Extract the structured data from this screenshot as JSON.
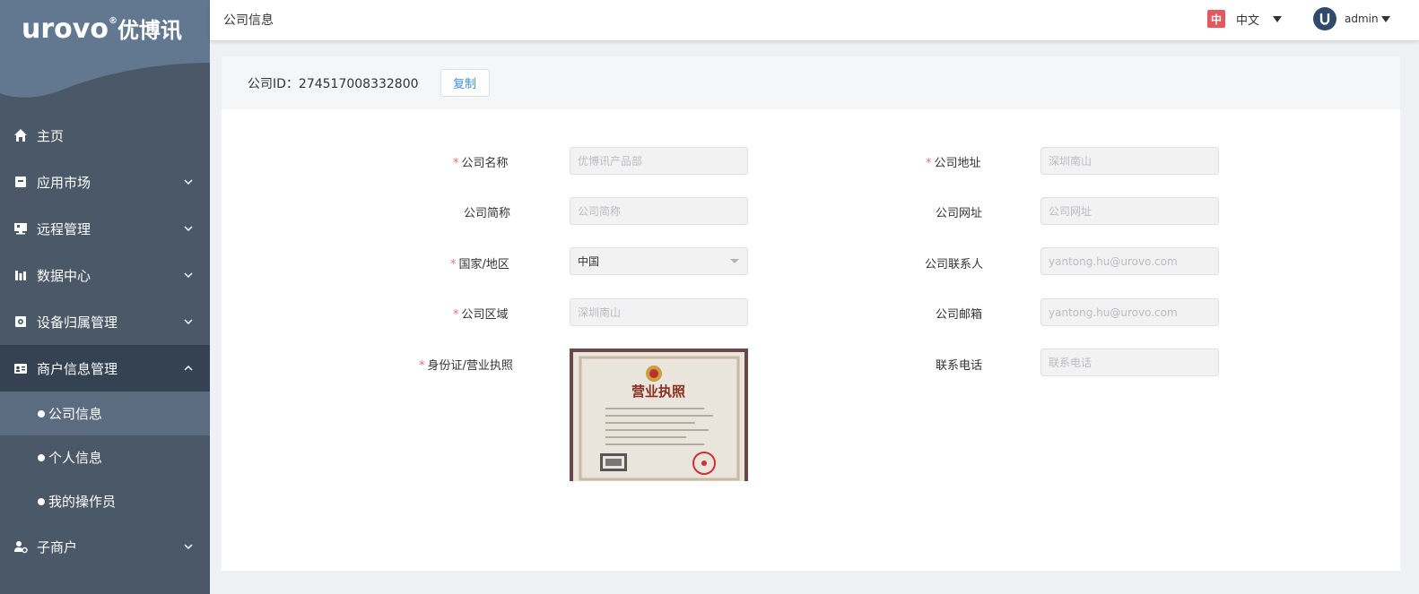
{
  "brand": {
    "logo_text": "urovo",
    "logo_cn": "优博讯",
    "reg_mark": "®"
  },
  "header": {
    "title": "公司信息",
    "lang_badge": "中",
    "lang_label": "中文",
    "user_name": "admin"
  },
  "sidebar": {
    "items": [
      {
        "label": "主页",
        "icon": "home-icon",
        "expandable": false
      },
      {
        "label": "应用市场",
        "icon": "store-icon",
        "expandable": true
      },
      {
        "label": "远程管理",
        "icon": "remote-icon",
        "expandable": true
      },
      {
        "label": "数据中心",
        "icon": "chart-icon",
        "expandable": true
      },
      {
        "label": "设备归属管理",
        "icon": "device-icon",
        "expandable": true
      },
      {
        "label": "商户信息管理",
        "icon": "id-card-icon",
        "expandable": true,
        "open": true
      },
      {
        "label": "子商户",
        "icon": "user-gear-icon",
        "expandable": true
      }
    ],
    "sub_items": [
      {
        "label": "公司信息",
        "active": true
      },
      {
        "label": "个人信息",
        "active": false
      },
      {
        "label": "我的操作员",
        "active": false
      }
    ]
  },
  "company": {
    "id_label": "公司ID：274517008332800",
    "copy_label": "复制"
  },
  "form": {
    "left": [
      {
        "label": "公司名称",
        "required": true,
        "placeholder": "优博讯产品部",
        "value": ""
      },
      {
        "label": "公司简称",
        "required": false,
        "placeholder": "公司简称",
        "value": ""
      },
      {
        "label": "国家/地区",
        "required": true,
        "placeholder": "",
        "value": "中国",
        "select": true
      },
      {
        "label": "公司区域",
        "required": true,
        "placeholder": "深圳南山",
        "value": ""
      },
      {
        "label": "身份证/营业执照",
        "required": true
      }
    ],
    "right": [
      {
        "label": "公司地址",
        "required": true,
        "placeholder": "深圳南山",
        "value": ""
      },
      {
        "label": "公司网址",
        "required": false,
        "placeholder": "公司网址",
        "value": ""
      },
      {
        "label": "公司联系人",
        "required": false,
        "placeholder": "yantong.hu@urovo.com",
        "value": ""
      },
      {
        "label": "公司邮箱",
        "required": false,
        "placeholder": "yantong.hu@urovo.com",
        "value": ""
      },
      {
        "label": "联系电话",
        "required": false,
        "placeholder": "联系电话",
        "value": ""
      }
    ],
    "license_title": "营业执照"
  },
  "colors": {
    "sidebar": "#4a5868",
    "sidebar_open": "#344252",
    "sub_active": "#5b6c80",
    "required": "#f56c6c",
    "link": "#3a8ee6"
  }
}
